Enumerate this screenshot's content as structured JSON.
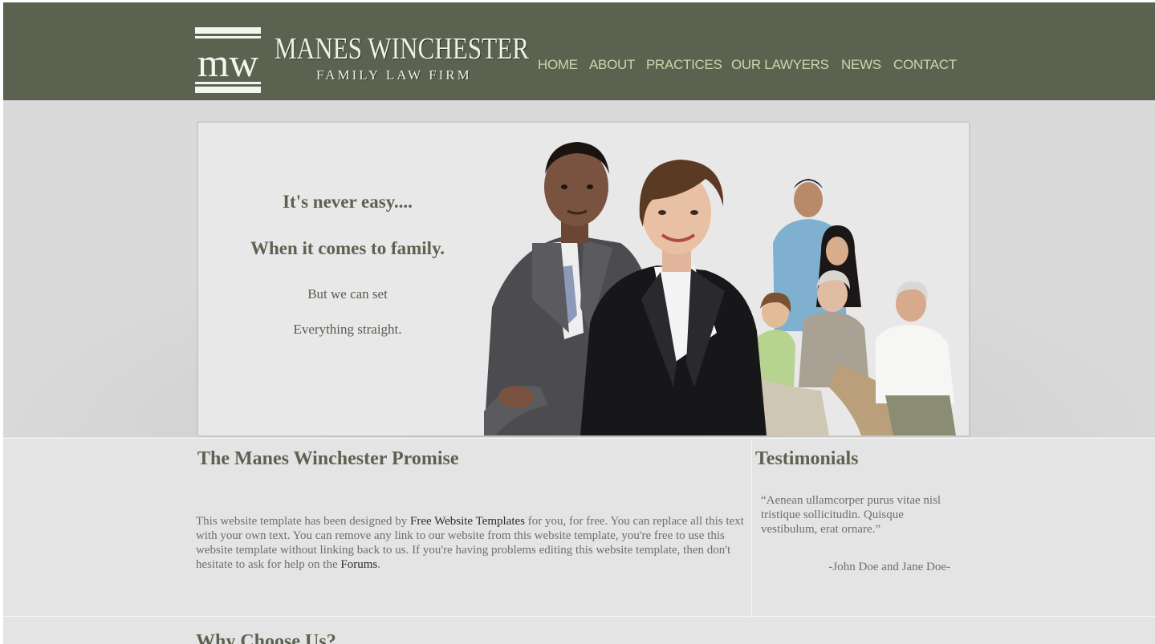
{
  "brand": {
    "name": "MANES WINCHESTER",
    "tagline": "FAMILY LAW FIRM",
    "colors": {
      "header": "#5b6350",
      "nav": "#c9d7a9",
      "heading": "#5b6350"
    }
  },
  "nav": {
    "items": [
      {
        "label": "HOME"
      },
      {
        "label": "ABOUT"
      },
      {
        "label": "PRACTICES"
      },
      {
        "label": "OUR LAWYERS"
      },
      {
        "label": "NEWS"
      },
      {
        "label": "CONTACT"
      }
    ]
  },
  "hero": {
    "line1": "It's never easy....",
    "line2": "When it comes to family.",
    "line3": "But we can set",
    "line4": "Everything straight."
  },
  "promise": {
    "title": "The Manes Winchester Promise",
    "text_a": "This website template has been designed by ",
    "link_a": "Free Website Templates",
    "text_b": " for you, for free. You can replace all this text with your own text. You can remove any link to our website from this website template, you're free to use this website template without linking back to us. If you're having problems editing this website template, then don't hesitate to ask for help on the ",
    "link_b": "Forums",
    "text_c": "."
  },
  "testimonials": {
    "title": "Testimonials",
    "quote": "“Aenean ullamcorper purus vitae nisl tristique sollicitudin. Quisque vestibulum, erat ornare.”",
    "author": "-John Doe and Jane Doe-"
  },
  "why": {
    "title": "Why Choose Us?"
  }
}
